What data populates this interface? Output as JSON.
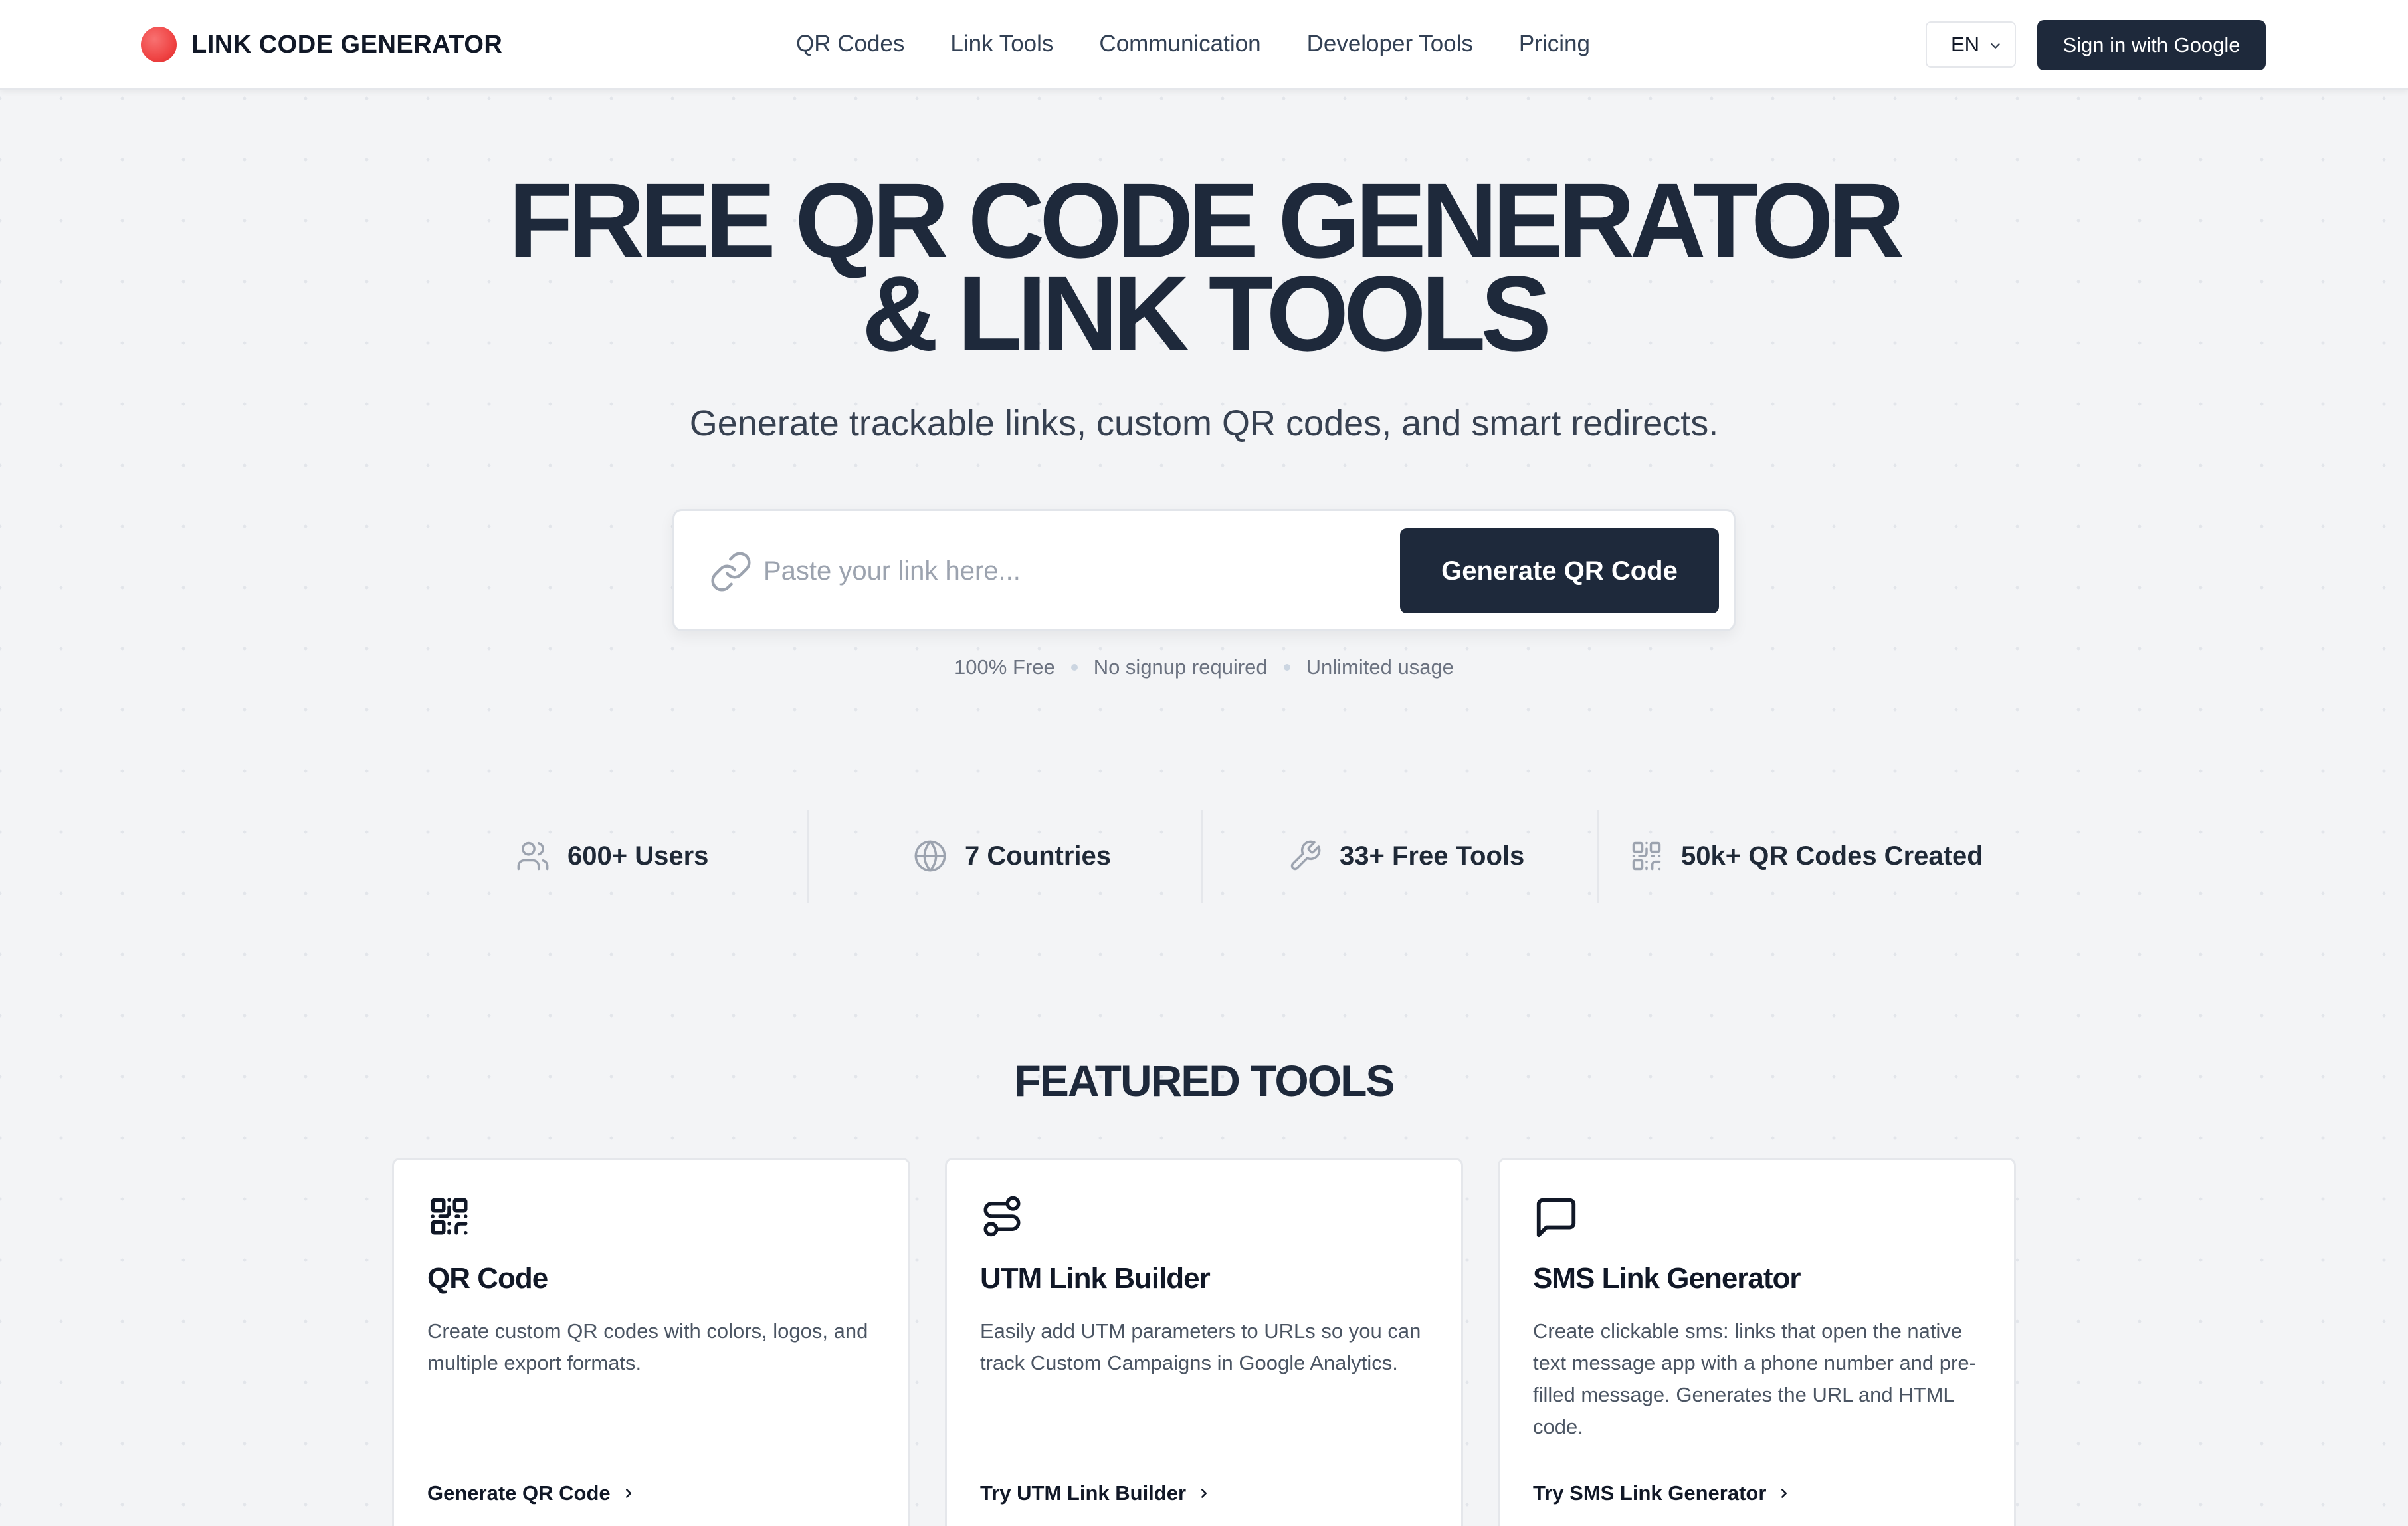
{
  "header": {
    "logo_text": "LINK CODE GENERATOR",
    "nav": [
      "QR Codes",
      "Link Tools",
      "Communication",
      "Developer Tools",
      "Pricing"
    ],
    "language": "EN",
    "signin_label": "Sign in with Google"
  },
  "hero": {
    "title": "FREE QR CODE GENERATOR\n& LINK TOOLS",
    "subtitle": "Generate trackable links, custom QR codes, and smart redirects.",
    "input_placeholder": "Paste your link here...",
    "input_value": "",
    "button_label": "Generate QR Code",
    "perks": [
      "100% Free",
      "No signup required",
      "Unlimited usage"
    ]
  },
  "stats": [
    {
      "icon": "users-icon",
      "label": "600+ Users"
    },
    {
      "icon": "globe-icon",
      "label": "7 Countries"
    },
    {
      "icon": "wrench-icon",
      "label": "33+ Free Tools"
    },
    {
      "icon": "qr-code-icon",
      "label": "50k+ QR Codes Created"
    }
  ],
  "featured": {
    "title": "FEATURED TOOLS",
    "cards": [
      {
        "icon": "qr-code-icon",
        "title": "QR Code",
        "description": "Create custom QR codes with colors, logos, and multiple export formats.",
        "link": "Generate QR Code"
      },
      {
        "icon": "route-icon",
        "title": "UTM Link Builder",
        "description": "Easily add UTM parameters to URLs so you can track Custom Campaigns in Google Analytics.",
        "link": "Try UTM Link Builder"
      },
      {
        "icon": "message-square-icon",
        "title": "SMS Link Generator",
        "description": "Create clickable sms: links that open the native text message app with a phone number and pre-filled message. Generates the URL and HTML code.",
        "link": "Try SMS Link Generator"
      }
    ]
  },
  "colors": {
    "primary": "#1e293b",
    "logo_dot": "#ef4444",
    "background": "#f3f4f6"
  }
}
